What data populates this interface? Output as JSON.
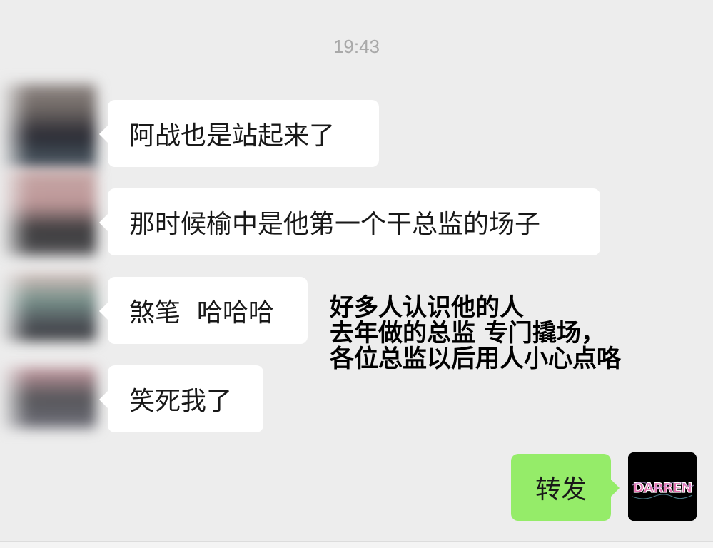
{
  "chat": {
    "timestamp": "19:43",
    "messages": [
      {
        "sender": "other",
        "text": "阿战也是站起来了"
      },
      {
        "sender": "other",
        "text": "那时候榆中是他第一个干总监的场子"
      },
      {
        "sender": "other",
        "text": "煞笔  哈哈哈"
      },
      {
        "sender": "other",
        "text": "笑死我了"
      },
      {
        "sender": "self",
        "text": "转发"
      }
    ],
    "overlay_lines": [
      "好多人认识他的人",
      "去年做的总监 专门撬场，",
      "各位总监以后用人小心点咯"
    ],
    "self_avatar_logo_text": "DARREN"
  },
  "colors": {
    "background": "#ededed",
    "incoming_bubble": "#ffffff",
    "outgoing_bubble": "#95ec69",
    "timestamp": "#a9a9a9"
  }
}
